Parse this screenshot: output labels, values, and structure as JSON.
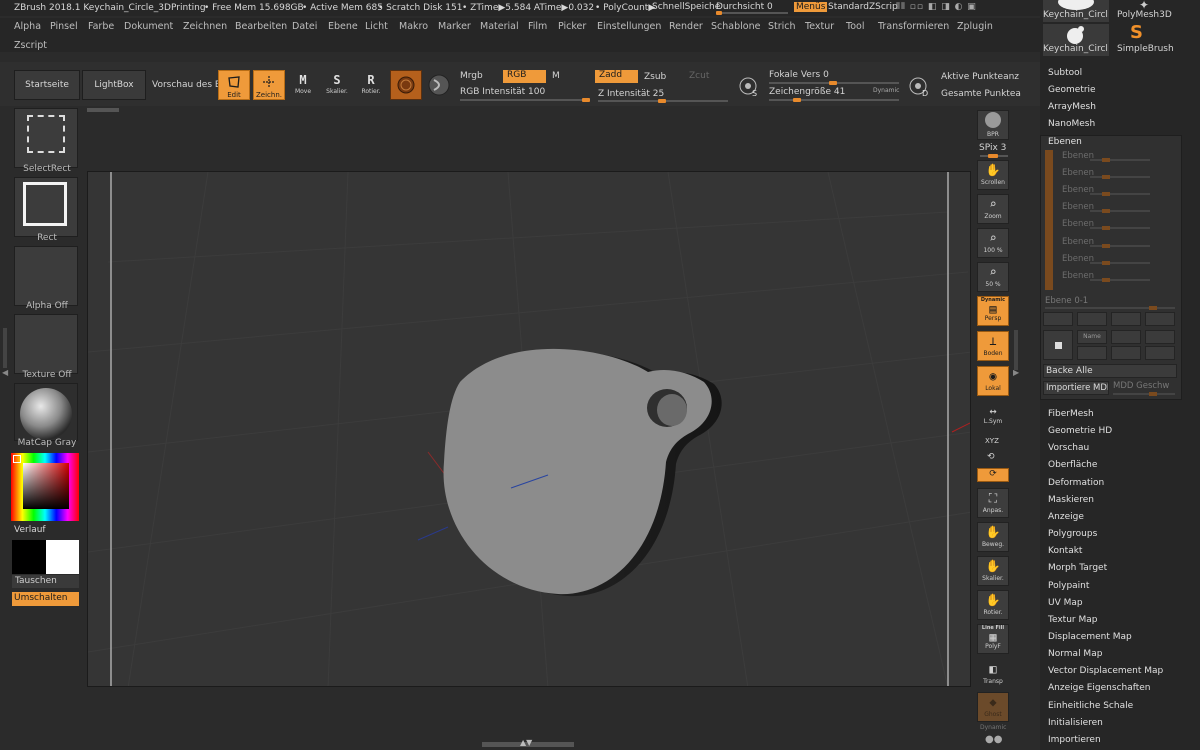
{
  "header": {
    "app_title": "ZBrush 2018.1 Keychain_Circle_3DPrinting",
    "free_mem": "• Free Mem 15.698GB",
    "active_mem": "• Active Mem 685",
    "scratch": "• Scratch Disk 151",
    "ztime": "• ZTime▶5.584 ATime▶0.032",
    "polycount": "• PolyCount▶",
    "quicksave": "SchnellSpeiche",
    "transparency": "Durchsicht 0",
    "menus": "Menüs",
    "script": "StandardZScrip"
  },
  "menu": {
    "row1": [
      "Alpha",
      "Pinsel",
      "Farbe",
      "Dokument",
      "Zeichnen",
      "Bearbeiten",
      "Datei",
      "Ebene",
      "Licht",
      "Makro",
      "Marker",
      "Material",
      "Film",
      "Picker",
      "Einstellungen",
      "Render",
      "Schablone",
      "Strich",
      "Textur",
      "Tool",
      "Transformieren",
      "Zplugin"
    ],
    "row2": [
      "Zscript"
    ]
  },
  "toolbar": {
    "home": "Startseite",
    "lightbox": "LightBox",
    "preview": "Vorschau des B",
    "edit": "Edit",
    "draw": "Zeichn.",
    "move": "Move",
    "scale": "Skalier.",
    "rotate": "Rotier.",
    "move_g": "M",
    "scale_g": "S",
    "rotate_g": "R",
    "mrgb": "Mrgb",
    "rgb": "RGB",
    "m": "M",
    "zadd": "Zadd",
    "zsub": "Zsub",
    "zcut": "Zcut",
    "rgb_intensity": "RGB Intensität 100",
    "z_intensity": "Z Intensität 25",
    "focal": "Fokale Vers 0",
    "draw_size": "Zeichengröße 41",
    "dynamic": "Dynamic",
    "active_points": "Aktive Punkteanz",
    "total_points": "Gesamte Punktea",
    "s_glyph": "S",
    "d_glyph": "D"
  },
  "left": {
    "select_rect": "SelectRect",
    "rect": "Rect",
    "alpha_off": "Alpha Off",
    "texture_off": "Texture Off",
    "matcap": "MatCap Gray",
    "gradient": "Verlauf",
    "swap": "Tauschen",
    "toggle": "Umschalten"
  },
  "right_shelf": {
    "bpr": "BPR",
    "spix": "SPix 3",
    "scroll": "Scrollen",
    "zoom": "Zoom",
    "z100": "100 %",
    "z50": "50 %",
    "dynamic": "Dynamic",
    "persp": "Persp",
    "floor": "Boden",
    "local": "Lokal",
    "lsym": "L.Sym",
    "xyz": "XYZ",
    "frame": "Anpas.",
    "move": "Beweg.",
    "scale": "Skalier.",
    "rotate": "Rotier.",
    "linefill": "Line Fill",
    "polyf": "PolyF",
    "transp": "Transp",
    "ghost": "Ghost",
    "dynamic2": "Dynamic"
  },
  "tool_panel": {
    "thumb1": "Keychain_Circl",
    "thumb2": "PolyMesh3D",
    "thumb3": "Keychain_Circl",
    "thumb4": "SimpleBrush",
    "items_top": [
      "Subtool",
      "Geometrie",
      "ArrayMesh",
      "NanoMesh"
    ],
    "layers_header": "Ebenen",
    "layer_rows": [
      "Ebenen",
      "Ebenen",
      "Ebenen",
      "Ebenen",
      "Ebenen",
      "Ebenen",
      "Ebenen",
      "Ebenen"
    ],
    "layer_slider": "Ebene 0-1",
    "name": "Name",
    "bake_all": "Backe Alle",
    "import_mdd": "Importiere MDD",
    "mdd_speed": "MDD Geschw",
    "items_bottom": [
      "FiberMesh",
      "Geometrie HD",
      "Vorschau",
      "Oberfläche",
      "Deformation",
      "Maskieren",
      "Anzeige",
      "Polygroups",
      "Kontakt",
      "Morph Target",
      "Polypaint",
      "UV Map",
      "Textur Map",
      "Displacement Map",
      "Normal Map",
      "Vector Displacement Map",
      "Anzeige Eigenschaften",
      "Einheitliche Schale",
      "Initialisieren",
      "Importieren"
    ]
  },
  "colors": {
    "accent": "#ef9a3a",
    "bg": "#2b2b2b",
    "canvas": "#353535"
  }
}
